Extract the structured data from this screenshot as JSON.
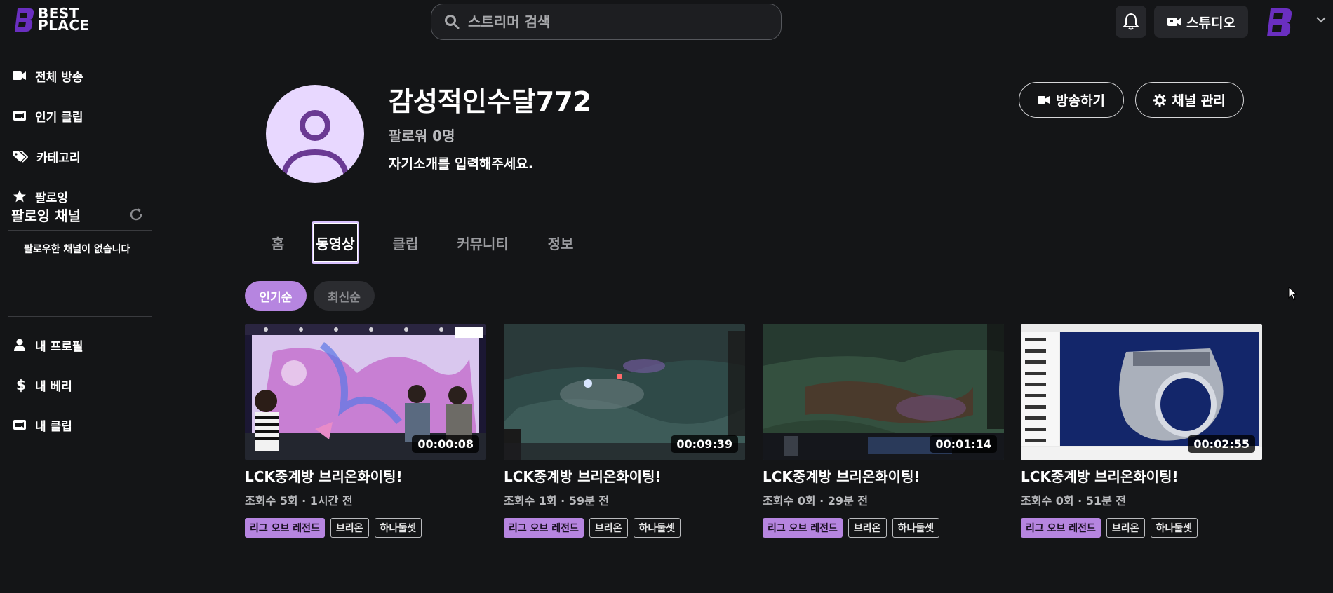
{
  "header": {
    "logo_line1": "BEST",
    "logo_line2": "PLACE",
    "search_placeholder": "스트리머 검색",
    "studio_label": "스튜디오"
  },
  "sidebar": {
    "items": [
      {
        "label": "전체 방송",
        "icon": "video-camera-icon"
      },
      {
        "label": "인기 클립",
        "icon": "clip-icon"
      },
      {
        "label": "카테고리",
        "icon": "tags-icon"
      },
      {
        "label": "팔로잉",
        "icon": "star-icon"
      }
    ],
    "following_title": "팔로잉 채널",
    "no_following_text": "팔로우한 채널이 없습니다",
    "bottom_items": [
      {
        "label": "내 프로필",
        "icon": "user-icon"
      },
      {
        "label": "내 베리",
        "icon": "dollar-icon"
      },
      {
        "label": "내 클립",
        "icon": "clip-icon"
      }
    ]
  },
  "profile": {
    "channel_name": "감성적인수달772",
    "followers": "팔로워 0명",
    "bio": "자기소개를 입력해주세요.",
    "broadcast_button": "방송하기",
    "manage_button": "채널 관리"
  },
  "tabs": [
    {
      "label": "홈",
      "active": false
    },
    {
      "label": "동영상",
      "active": true
    },
    {
      "label": "클립",
      "active": false
    },
    {
      "label": "커뮤니티",
      "active": false
    },
    {
      "label": "정보",
      "active": false
    }
  ],
  "sort": {
    "popular": "인기순",
    "latest": "최신순",
    "selected": "인기순"
  },
  "videos": [
    {
      "title": "LCK중계방 브리온화이팅!",
      "meta": "조회수 5회 · 1시간 전",
      "duration": "00:00:08",
      "tags": [
        "리그 오브 레전드",
        "브리온",
        "하나둘셋"
      ]
    },
    {
      "title": "LCK중계방 브리온화이팅!",
      "meta": "조회수 1회 · 59분 전",
      "duration": "00:09:39",
      "tags": [
        "리그 오브 레전드",
        "브리온",
        "하나둘셋"
      ]
    },
    {
      "title": "LCK중계방 브리온화이팅!",
      "meta": "조회수 0회 · 29분 전",
      "duration": "00:01:14",
      "tags": [
        "리그 오브 레전드",
        "브리온",
        "하나둘셋"
      ]
    },
    {
      "title": "LCK중계방 브리온화이팅!",
      "meta": "조회수 0회 · 51분 전",
      "duration": "00:02:55",
      "tags": [
        "리그 오브 레전드",
        "브리온",
        "하나둘셋"
      ]
    }
  ],
  "colors": {
    "background": "#141517",
    "accent": "#b685e0",
    "avatar_bg": "#e8d8ff"
  }
}
